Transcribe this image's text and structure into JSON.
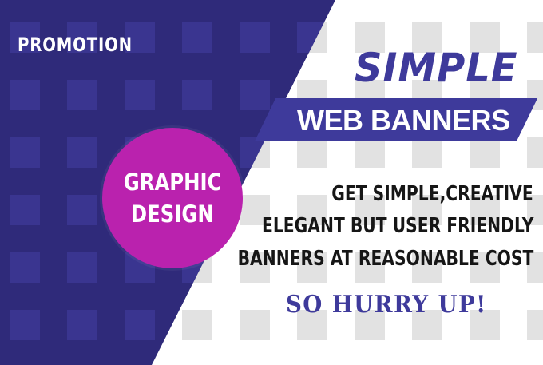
{
  "banner": {
    "promo_label": "PROMOTION",
    "circle": {
      "line1": "GRAPHIC",
      "line2": "DESIGN"
    },
    "headline": "SIMPLE",
    "subheadline": "WEB BANNERS",
    "body_lines": [
      "GET SIMPLE,CREATIVE",
      "ELEGANT BUT USER FRIENDLY",
      "BANNERS AT REASONABLE COST"
    ],
    "cta": "SO HURRY UP!"
  },
  "colors": {
    "navy": "#2f2a7a",
    "brand_blue": "#3e3a9b",
    "magenta": "#ba22ae",
    "tile_light": "#e2e2e2",
    "tile_dark": "#3a3590",
    "text_dark": "#161616"
  }
}
